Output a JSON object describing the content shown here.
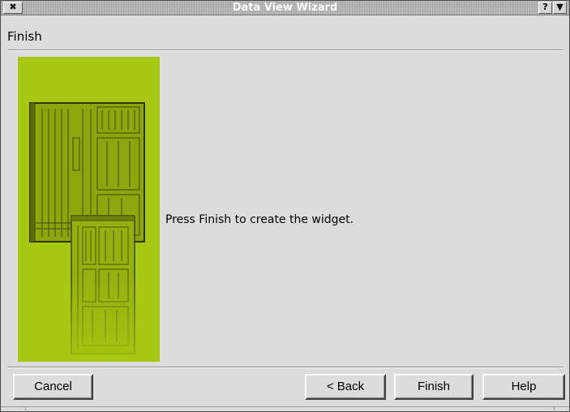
{
  "window": {
    "title": "Data View Wizard",
    "close_glyph": "✖",
    "help_glyph": "?",
    "menu_glyph": "▼"
  },
  "page": {
    "heading": "Finish",
    "message": "Press Finish to create the widget."
  },
  "image": {
    "icon": "wizard-forms-illustration",
    "background_color": "#a7c812"
  },
  "buttons": {
    "cancel": "Cancel",
    "back": "< Back",
    "finish": "Finish",
    "help": "Help"
  }
}
